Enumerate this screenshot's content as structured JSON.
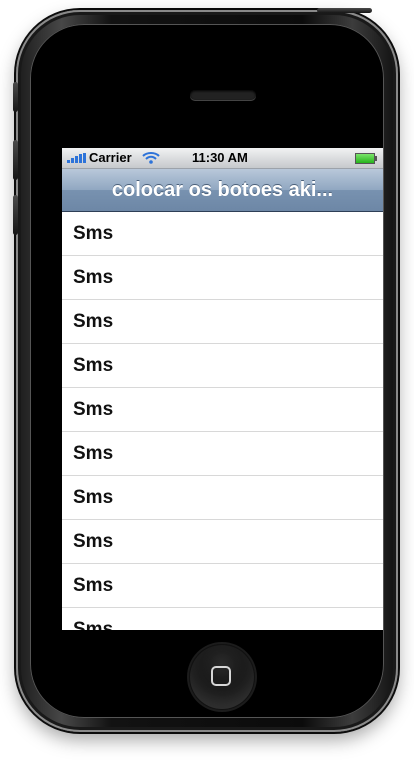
{
  "status_bar": {
    "carrier": "Carrier",
    "time": "11:30 AM"
  },
  "navigation": {
    "title": "colocar os botoes aki..."
  },
  "table": {
    "rows": [
      {
        "label": "Sms"
      },
      {
        "label": "Sms"
      },
      {
        "label": "Sms"
      },
      {
        "label": "Sms"
      },
      {
        "label": "Sms"
      },
      {
        "label": "Sms"
      },
      {
        "label": "Sms"
      },
      {
        "label": "Sms"
      },
      {
        "label": "Sms"
      },
      {
        "label": "Sms"
      }
    ]
  },
  "icons": {
    "signal": "signal-strength-icon",
    "wifi": "wifi-icon",
    "battery": "battery-icon",
    "home": "home-button-icon"
  }
}
